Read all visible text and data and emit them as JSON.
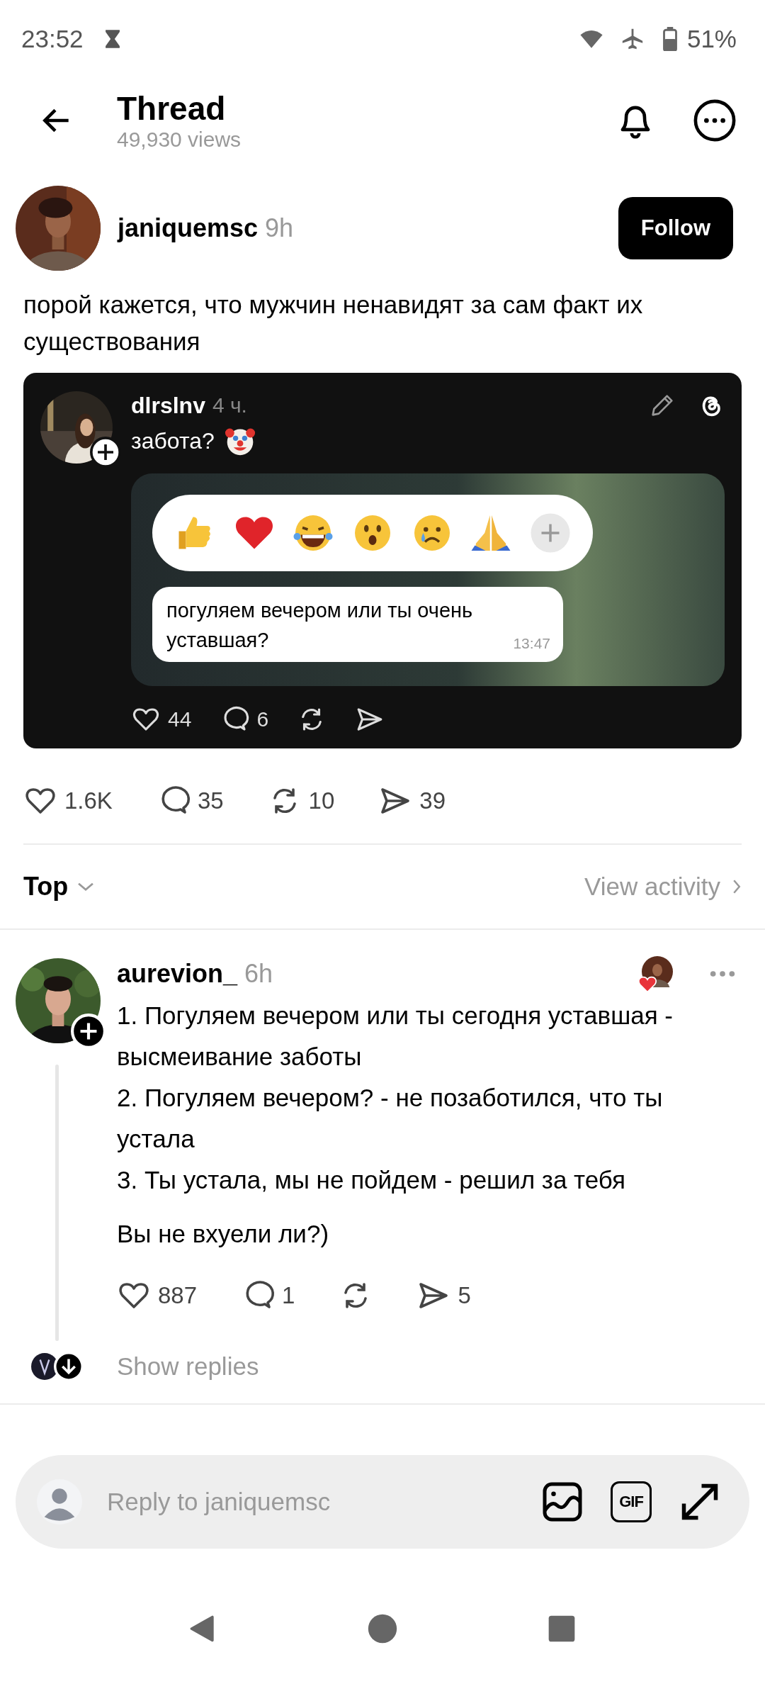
{
  "status_bar": {
    "time": "23:52",
    "battery": "51%"
  },
  "header": {
    "title": "Thread",
    "views": "49,930 views"
  },
  "post": {
    "author": "janiquemsc",
    "time": "9h",
    "follow": "Follow",
    "text": "порой кажется, что мужчин ненавидят за сам факт их существования",
    "quoted": {
      "author": "dlrslnv",
      "time": "4 ч.",
      "text": "забота?",
      "reactions": [
        {
          "kind": "thumbs"
        },
        {
          "kind": "heart"
        },
        {
          "kind": "laugh"
        },
        {
          "kind": "surprised"
        },
        {
          "kind": "sad"
        },
        {
          "kind": "pray"
        },
        {
          "kind": "plus"
        }
      ],
      "message": "погуляем вечером или ты очень уставшая?",
      "message_time": "13:47",
      "stats": [
        {
          "kind": "like",
          "count": "44"
        },
        {
          "kind": "reply",
          "count": "6"
        },
        {
          "kind": "repost"
        },
        {
          "kind": "share"
        }
      ]
    },
    "stats": [
      {
        "kind": "like",
        "count": "1.6K"
      },
      {
        "kind": "reply",
        "count": "35"
      },
      {
        "kind": "repost",
        "count": "10"
      },
      {
        "kind": "share",
        "count": "39"
      }
    ]
  },
  "sort": {
    "label": "Top",
    "activity": "View activity"
  },
  "comments": [
    {
      "author": "aurevion_",
      "time": "6h",
      "lines": [
        "1. Погуляем вечером или ты сегодня уставшая - высмеивание заботы",
        "2. Погуляем вечером? - не позаботился, что ты устала",
        "3. Ты устала, мы не пойдем - решил за тебя"
      ],
      "closing": "Вы не вхуели ли?)",
      "stats": [
        {
          "kind": "like",
          "count": "887"
        },
        {
          "kind": "reply",
          "count": "1"
        },
        {
          "kind": "repost"
        },
        {
          "kind": "share",
          "count": "5"
        }
      ],
      "show_replies": "Show replies"
    }
  ],
  "reply_bar": {
    "placeholder": "Reply to janiquemsc",
    "gif_label": "GIF"
  }
}
